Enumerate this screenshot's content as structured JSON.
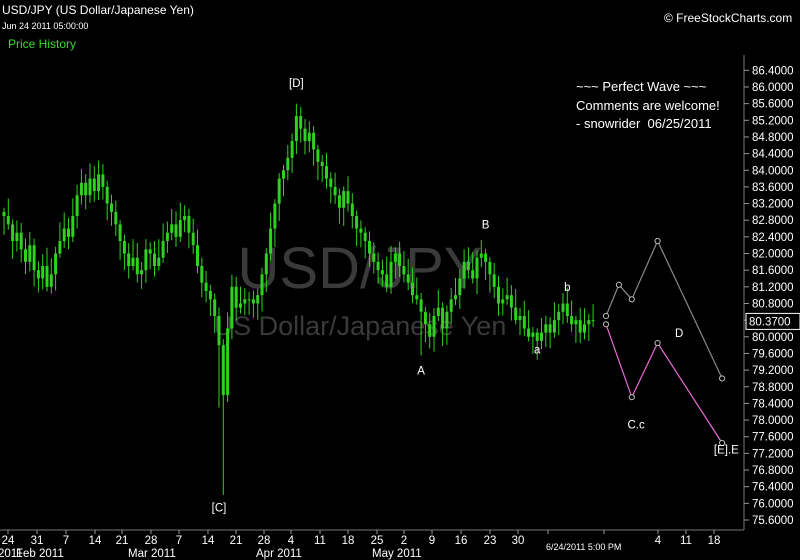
{
  "header": {
    "symbol_title": "USD/JPY (US Dollar/Japanese Yen)",
    "timestamp": "Jun 24 2011 05:00:00",
    "panel_label": "Price History",
    "brand": "© FreeStockCharts.com"
  },
  "comment": {
    "line1": "~~~ Perfect Wave ~~~",
    "line2": "Comments are welcome!",
    "line3": "- snowrider  06/25/2011"
  },
  "colors": {
    "candle": "#2fd21f",
    "projection_pink": "#e86ad8",
    "projection_gray": "#8a8a8a",
    "watermark": "#3a3a3a",
    "last_price_box": "#ffffff"
  },
  "chart_data": {
    "type": "candlestick",
    "watermark_symbol": "USD/JPY",
    "watermark_name": "US Dollar/Japanese Yen",
    "last_price": "80.3700",
    "crosshair_label": "6/24/2011 5:00 PM",
    "ylim": [
      75.6,
      86.6
    ],
    "y_ticks": [
      "86.4000",
      "86.0000",
      "85.6000",
      "85.2000",
      "84.8000",
      "84.4000",
      "84.0000",
      "83.6000",
      "83.2000",
      "82.8000",
      "82.4000",
      "82.0000",
      "81.6000",
      "81.2000",
      "80.8000",
      "80.4000",
      "80.0000",
      "79.6000",
      "79.2000",
      "78.8000",
      "78.4000",
      "78.0000",
      "77.6000",
      "77.2000",
      "76.8000",
      "76.4000",
      "76.0000",
      "75.6000"
    ],
    "x_ticks": [
      "24",
      "31",
      "7",
      "14",
      "21",
      "28",
      "7",
      "14",
      "21",
      "28",
      "4",
      "11",
      "18",
      "25",
      "2",
      "9",
      "16",
      "23",
      "30",
      "",
      "",
      "4",
      "11",
      "18"
    ],
    "x_months": [
      "2011",
      "Feb 2011",
      "Mar 2011",
      "Apr 2011",
      "May 2011"
    ],
    "closes": [
      82.9,
      82.7,
      82.3,
      82.5,
      82.1,
      81.8,
      82.2,
      81.6,
      81.4,
      81.7,
      81.2,
      81.5,
      82.0,
      82.3,
      82.6,
      82.4,
      82.9,
      83.4,
      83.7,
      83.4,
      83.8,
      83.5,
      83.9,
      83.6,
      83.2,
      83.0,
      82.7,
      82.3,
      82.0,
      81.7,
      81.9,
      81.5,
      81.6,
      82.1,
      82.0,
      81.7,
      81.9,
      82.3,
      82.5,
      82.7,
      82.4,
      82.8,
      82.9,
      82.5,
      82.2,
      81.7,
      81.3,
      81.1,
      80.9,
      80.5,
      79.8,
      78.6,
      80.2,
      81.2,
      80.7,
      80.8,
      80.9,
      80.9,
      80.8,
      81.0,
      81.5,
      82.0,
      82.6,
      83.2,
      83.8,
      84.0,
      84.3,
      84.7,
      85.3,
      85.0,
      84.7,
      84.9,
      84.5,
      84.2,
      84.1,
      83.8,
      83.6,
      83.4,
      83.1,
      83.5,
      83.2,
      82.9,
      82.6,
      82.5,
      82.3,
      82.0,
      81.8,
      81.6,
      81.5,
      81.2,
      81.8,
      82.0,
      81.7,
      81.5,
      81.3,
      81.0,
      80.9,
      80.6,
      80.3,
      80.0,
      80.5,
      80.7,
      80.2,
      80.6,
      80.9,
      81.0,
      81.4,
      81.8,
      81.6,
      81.4,
      81.9,
      82.0,
      81.8,
      81.5,
      81.2,
      80.8,
      80.9,
      81.0,
      80.7,
      80.4,
      80.5,
      80.2,
      80.0,
      80.1,
      79.9,
      80.1,
      80.3,
      80.1,
      80.4,
      80.6,
      80.8,
      80.5,
      80.3,
      80.4,
      80.1,
      80.3,
      80.4,
      80.4
    ],
    "wave_labels": [
      {
        "text": "[C]",
        "x_index": 50,
        "price": 75.8
      },
      {
        "text": "[D]",
        "x_index": 68,
        "price": 86.0
      },
      {
        "text": "A",
        "x_index": 97,
        "price": 79.1
      },
      {
        "text": "B",
        "x_index": 112,
        "price": 82.6
      },
      {
        "text": "a",
        "x_index": 124,
        "price": 79.6
      },
      {
        "text": "b",
        "x_index": 131,
        "price": 81.1
      },
      {
        "text": "C.c",
        "x_index": 147,
        "price": 77.8
      },
      {
        "text": "D",
        "x_index": 157,
        "price": 80.0
      },
      {
        "text": "[E].E",
        "x_index": 168,
        "price": 77.2
      }
    ],
    "projection_pink": [
      [
        140,
        80.3
      ],
      [
        146,
        78.55
      ],
      [
        152,
        79.85
      ],
      [
        167,
        77.45
      ]
    ],
    "projection_gray": [
      [
        140,
        80.5
      ],
      [
        143,
        81.25
      ],
      [
        146,
        80.9
      ],
      [
        152,
        82.3
      ],
      [
        167,
        79.0
      ]
    ]
  }
}
